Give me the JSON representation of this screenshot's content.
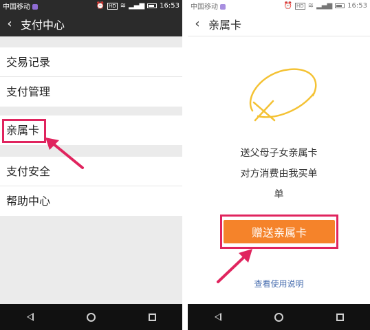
{
  "left_screen": {
    "status": {
      "carrier": "中国移动",
      "time": "16:53"
    },
    "title": "支付中心",
    "menu_groups": [
      [
        "交易记录",
        "支付管理"
      ],
      [
        "亲属卡"
      ],
      [
        "支付安全",
        "帮助中心"
      ]
    ]
  },
  "right_screen": {
    "status": {
      "carrier": "中国移动",
      "time": "16:53"
    },
    "title": "亲属卡",
    "description": [
      "送父母子女亲属卡",
      "对方消费由我买单",
      "单"
    ],
    "gift_button": "赠送亲属卡",
    "help_link": "查看使用说明"
  },
  "colors": {
    "highlight": "#e0245e",
    "button": "#f5832a",
    "link": "#4a6fb0",
    "dark_bar": "#2b2b2b"
  },
  "icons": [
    "back-arrow",
    "alarm",
    "hd",
    "wifi",
    "signal",
    "battery",
    "nav-back",
    "nav-home",
    "nav-recent"
  ]
}
